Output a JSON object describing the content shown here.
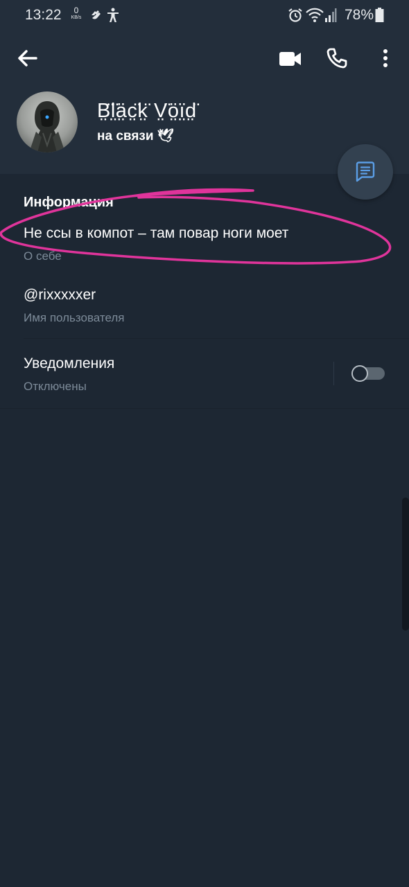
{
  "status_bar": {
    "time": "13:22",
    "net_speed_value": "0",
    "net_speed_unit": "KB/s",
    "battery_percent": "78%",
    "icons": [
      "hand-icon",
      "accessibility-icon",
      "alarm-icon",
      "wifi-icon",
      "signal-icon",
      "battery-icon"
    ]
  },
  "toolbar": {
    "icons": [
      "back-arrow-icon",
      "video-call-icon",
      "phone-icon",
      "more-vertical-icon"
    ]
  },
  "profile": {
    "name": "B̤̈l̤̈ä̤c̤̈k̤̈ V̤̈ö̤ï̤d̤̈",
    "status": "на связи 🕊"
  },
  "fab": {
    "icon": "message-icon"
  },
  "info": {
    "section_title": "Информация",
    "bio": "Не ссы в компот – там повар ноги моет",
    "bio_label": "О себе",
    "username": "@rixxxxxer",
    "username_label": "Имя пользователя"
  },
  "notifications": {
    "title": "Уведомления",
    "state": "Отключены",
    "enabled": false
  },
  "colors": {
    "header_bg": "#232e3b",
    "body_bg": "#1d2733",
    "secondary_text": "#7d8b99",
    "annotation": "#e0349b",
    "fab_icon": "#5b9ee6"
  }
}
